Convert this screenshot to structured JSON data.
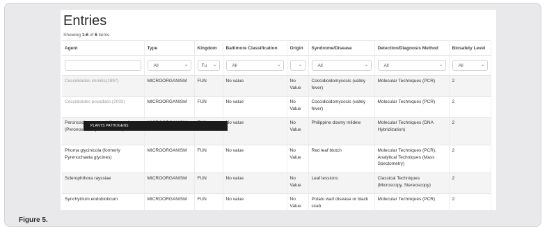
{
  "page": {
    "title": "Entries",
    "summary_prefix": "Showing ",
    "summary_range": "1-6",
    "summary_mid": " of ",
    "summary_total": "6",
    "summary_suffix": " items.",
    "caption": "Figure 5."
  },
  "table": {
    "columns": [
      "Agent",
      "Type",
      "Kingdom",
      "Baltimore Classification",
      "Origin",
      "Syndrome/Disease",
      "Detection/Diagnosis Method",
      "Biosafety Level"
    ],
    "filters": {
      "type": "All",
      "kingdom": "Fu",
      "baltimore": "All",
      "origin": "",
      "syndrome": "All",
      "detection": "All",
      "biosafety": "All"
    },
    "rows": [
      {
        "agent": "Coccidioides immitis(1997)",
        "type": "MICROORGANISM",
        "kingdom": "FUN",
        "baltimore": "No value",
        "origin": "No Value",
        "syndrome": "Coccidioidomycosis (valley fever)",
        "detection": "Molecular Techniques (PCR)",
        "biosafety": "2"
      },
      {
        "agent": "Coccidioides posadasii (2003)",
        "type": "MICROORGANISM",
        "kingdom": "FUN",
        "baltimore": "No value",
        "origin": "No Value",
        "syndrome": "Coccidioidomycosis (valley fever)",
        "detection": "Molecular Techniques (PCR)",
        "biosafety": "2"
      },
      {
        "agent": "Peronosclerospora philippinensis (Peronosclerospora sacchari)",
        "type": "MICROORGANISM",
        "kingdom": "FUN",
        "baltimore": "No value",
        "origin": "No Value",
        "syndrome": "Philippine downy mildew",
        "detection": "Molecular Techniques (DNA Hybridization)",
        "biosafety": "2"
      },
      {
        "agent": "Phoma glycinicola (formerly Pyrenochaeta glycines)",
        "type": "MICROORGANISM",
        "kingdom": "FUN",
        "baltimore": "No value",
        "origin": "No Value",
        "syndrome": "Red leaf blotch",
        "detection": "Molecular Techniques (PCR), Analytical Techniques (Mass Spectometry)",
        "biosafety": "2"
      },
      {
        "agent": "Sclerophthora rayssiae",
        "type": "MICROORGANISM",
        "kingdom": "FUN",
        "baltimore": "No value",
        "origin": "No Value",
        "syndrome": "Leaf lessions",
        "detection": "Classical Techniques (Microscopy, Stereoscopy)",
        "biosafety": "2"
      },
      {
        "agent": "Synchytrium endobioticum",
        "type": "MICROORGANISM",
        "kingdom": "FUN",
        "baltimore": "No value",
        "origin": "No Value",
        "syndrome": "Potato wart disease or black scab",
        "detection": "Molecular Techniques (PCR)",
        "biosafety": "2"
      }
    ]
  },
  "tooltip": {
    "text": "PLANTS PATHOGENS"
  },
  "icons": {
    "dropdown": "chevron-down-icon"
  }
}
